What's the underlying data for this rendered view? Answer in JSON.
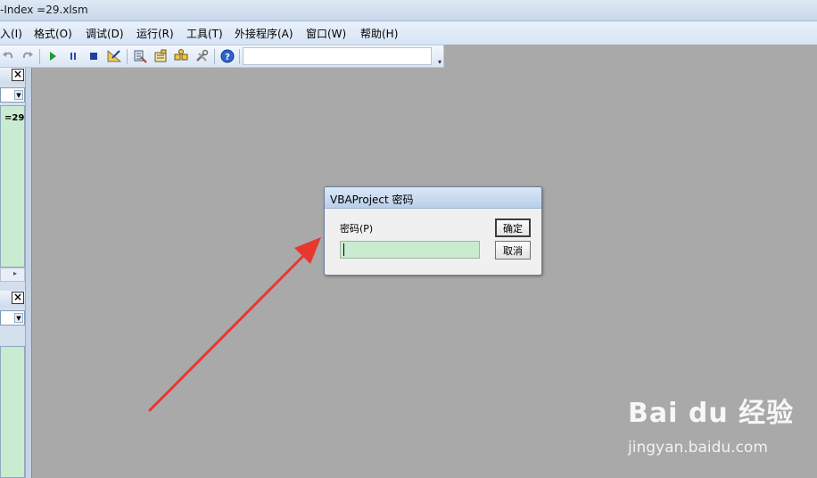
{
  "window": {
    "title": "-Index =29.xlsm"
  },
  "menu": [
    "入(I)",
    "格式(O)",
    "调试(D)",
    "运行(R)",
    "工具(T)",
    "外接程序(A)",
    "窗口(W)",
    "帮助(H)"
  ],
  "toolbar": {
    "icons": [
      "undo-icon",
      "redo-icon",
      "run-icon",
      "break-icon",
      "reset-icon",
      "design-mode-icon",
      "project-explorer-icon",
      "properties-icon",
      "object-browser-icon",
      "toolbox-icon",
      "help-icon"
    ],
    "combo_value": ""
  },
  "left_pane": {
    "project_text": "=29"
  },
  "dialog": {
    "title": "VBAProject 密码",
    "password_label": "密码(P)",
    "password_value": "",
    "ok_label": "确定",
    "cancel_label": "取消"
  },
  "colors": {
    "workspace": "#a9a9a9",
    "input_bg": "#c9ebcf",
    "arrow": "#e8372f"
  },
  "watermark": {
    "logo": "Bai du 经验",
    "url": "jingyan.baidu.com"
  }
}
